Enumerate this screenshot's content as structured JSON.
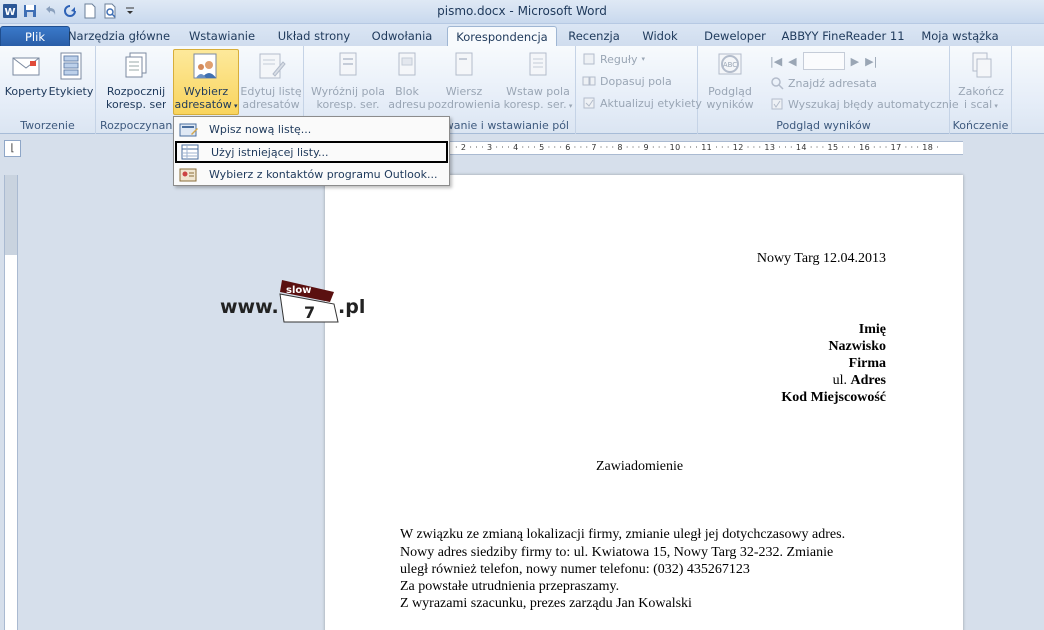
{
  "window": {
    "title": "pismo.docx - Microsoft Word"
  },
  "qat": {
    "icons": [
      "word-icon",
      "save-icon",
      "undo-icon",
      "redo-icon",
      "new-document-icon",
      "print-preview-icon",
      "customize-qat-icon"
    ]
  },
  "tabs": [
    {
      "label": "Plik"
    },
    {
      "label": "Narzędzia główne"
    },
    {
      "label": "Wstawianie"
    },
    {
      "label": "Układ strony"
    },
    {
      "label": "Odwołania"
    },
    {
      "label": "Korespondencja"
    },
    {
      "label": "Recenzja"
    },
    {
      "label": "Widok"
    },
    {
      "label": "Deweloper"
    },
    {
      "label": "ABBYY FineReader 11"
    },
    {
      "label": "Moja wstążka"
    }
  ],
  "ribbon": {
    "groups": {
      "tworzenie": "Tworzenie",
      "rozpoczynanie": "Rozpoczynanie",
      "wstawianie": "ywanie i wstawianie pól",
      "podglad": "Podgląd wyników",
      "konczenie": "Kończenie"
    },
    "buttons": {
      "koperty": "Koperty",
      "etykiety": "Etykiety",
      "rozpocznij1": "Rozpocznij",
      "rozpocznij2": "koresp. seryjną",
      "wybierz1": "Wybierz",
      "wybierz2": "adresatów",
      "edytuj1": "Edytuj listę",
      "edytuj2": "adresatów",
      "wyroznij1": "Wyróżnij pola",
      "wyroznij2": "koresp. ser.",
      "blok1": "Blok",
      "blok2": "adresu",
      "wiersz1": "Wiersz",
      "wiersz2": "pozdrowienia",
      "wstaw1": "Wstaw pola",
      "wstaw2": "koresp. ser.",
      "reguly": "Reguły",
      "dopasuj": "Dopasuj pola",
      "aktualizuj": "Aktualizuj etykiety",
      "podglad1": "Podgląd",
      "podglad2": "wyników",
      "znajdz": "Znajdź adresata",
      "wyszukaj": "Wyszukaj błędy automatycznie",
      "zakoncz1": "Zakończ",
      "zakoncz2": "i scal"
    }
  },
  "menu": {
    "items": [
      {
        "label": "Wpisz nową listę..."
      },
      {
        "label": "Użyj istniejącej listy..."
      },
      {
        "label": "Wybierz z kontaktów programu Outlook..."
      }
    ]
  },
  "ruler": {
    "marks": "· 2 · · · 3 · · · 4 · · · 5 · · · 6 · · · 7 · · · 8 · · · 9 · · · 10 · · · 11 · · · 12 · · · 13 · · · 14 · · · 15 · · · 16 · · · 17 · · · 18 ·"
  },
  "logo": {
    "prefix": "www.",
    "badge_top": "slow",
    "badge_num": "7",
    "suffix": ".pl"
  },
  "document": {
    "date": "Nowy Targ 12.04.2013",
    "recipient": {
      "name": "Imię",
      "surname": "Nazwisko",
      "company": "Firma",
      "street_prefix": "ul. ",
      "street": "Adres",
      "postal": "Kod Miejscowość"
    },
    "subject": "Zawiadomienie",
    "body": [
      "W związku ze zmianą lokalizacji firmy, zmianie uległ jej dotychczasowy adres.",
      "Nowy adres siedziby firmy to: ul. Kwiatowa 15, Nowy Targ 32-232. Zmianie",
      "uległ również telefon, nowy numer telefonu: (032) 435267123",
      "Za powstałe utrudnienia przepraszamy.",
      "Z wyrazami szacunku, prezes zarządu Jan Kowalski"
    ]
  }
}
